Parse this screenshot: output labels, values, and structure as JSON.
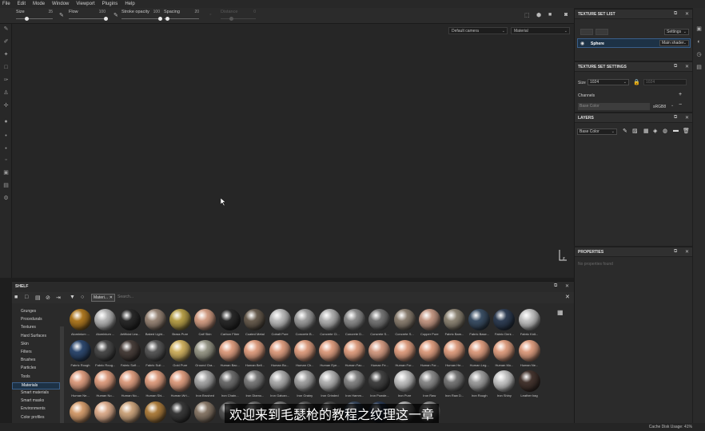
{
  "menu": [
    "File",
    "Edit",
    "Mode",
    "Window",
    "Viewport",
    "Plugins",
    "Help"
  ],
  "toolbar": {
    "size": {
      "label": "Size",
      "value": "35",
      "fill": 0.3
    },
    "flow": {
      "label": "Flow",
      "value": "100",
      "fill": 1.0
    },
    "stroke_opacity": {
      "label": "Stroke opacity",
      "value": "100",
      "fill": 1.0
    },
    "spacing": {
      "label": "Spacing",
      "value": "20",
      "fill": 0.1
    },
    "distance": {
      "label": "Distance",
      "value": "0",
      "fill": 0.3
    }
  },
  "viewport": {
    "camera": "Default camera",
    "mode": "Material"
  },
  "texture_set_list": {
    "title": "TEXTURE SET LIST",
    "settings_label": "Settings",
    "items": [
      {
        "name": "Sphere",
        "shader": "Main shader"
      }
    ]
  },
  "texture_set_settings": {
    "title": "TEXTURE SET SETTINGS",
    "size_label": "Size",
    "size_value": "1024",
    "size_value_2": "1024",
    "channels_label": "Channels",
    "channel": {
      "name": "Base Color",
      "format": "sRGB8"
    }
  },
  "layers": {
    "title": "LAYERS",
    "channel": "Base Color"
  },
  "properties": {
    "title": "PROPERTIES",
    "empty_text": "No properties found"
  },
  "shelf": {
    "title": "SHELF",
    "filter_tag": "Materi...",
    "search_placeholder": "Search...",
    "categories": [
      "Grunges",
      "Procedurals",
      "Textures",
      "Hard Surfaces",
      "Skin",
      "Filters",
      "Brushes",
      "Particles",
      "Tools",
      "Materials",
      "Smart materials",
      "Smart masks",
      "Environments",
      "Color profiles"
    ],
    "selected_category": "Materials",
    "materials": [
      {
        "name": "Aluminium ...",
        "color": "#b07a22"
      },
      {
        "name": "Aluminium ...",
        "color": "#b9b9b9"
      },
      {
        "name": "Artificial Lea...",
        "color": "#2a2a2a"
      },
      {
        "name": "Baked Light...",
        "color": "#9a8778"
      },
      {
        "name": "Brass Pure",
        "color": "#b9a14a"
      },
      {
        "name": "Calf Skin",
        "color": "#d6a086"
      },
      {
        "name": "Carbon Fiber",
        "color": "#2a2a2a"
      },
      {
        "name": "Coated Metal",
        "color": "#6a5e50"
      },
      {
        "name": "Cobalt Pure",
        "color": "#bfbfbf"
      },
      {
        "name": "Concrete B...",
        "color": "#9f9f9f"
      },
      {
        "name": "Concrete Cl...",
        "color": "#b3b3b3"
      },
      {
        "name": "Concrete D...",
        "color": "#8e8e8e"
      },
      {
        "name": "Concrete S...",
        "color": "#777777"
      },
      {
        "name": "Concrete S...",
        "color": "#8c8072"
      },
      {
        "name": "Copper Pure",
        "color": "#c79a86"
      },
      {
        "name": "Fabric Bam...",
        "color": "#8f8676"
      },
      {
        "name": "Fabric Base...",
        "color": "#3c5066"
      },
      {
        "name": "Fabric Deni...",
        "color": "#303f55"
      },
      {
        "name": "Fabric Knit...",
        "color": "#c6c6c6"
      },
      {
        "name": "Fabric Rough",
        "color": "#2f4a70"
      },
      {
        "name": "Fabric Roug...",
        "color": "#4b4b4b"
      },
      {
        "name": "Fabric Soft ...",
        "color": "#4a403c"
      },
      {
        "name": "Fabric Suit ...",
        "color": "#595959"
      },
      {
        "name": "Gold Pure",
        "color": "#d3b463"
      },
      {
        "name": "Ground Gra...",
        "color": "#9a9a8a"
      },
      {
        "name": "Human Bac...",
        "color": "#e2a183"
      },
      {
        "name": "Human Bell...",
        "color": "#e2a183"
      },
      {
        "name": "Human Bu...",
        "color": "#e2a183"
      },
      {
        "name": "Human Ch...",
        "color": "#e2a183"
      },
      {
        "name": "Human Eye...",
        "color": "#e2a183"
      },
      {
        "name": "Human Fac...",
        "color": "#e2a183"
      },
      {
        "name": "Human Fe...",
        "color": "#d89f86"
      },
      {
        "name": "Human For...",
        "color": "#e2a183"
      },
      {
        "name": "Human For...",
        "color": "#e2a183"
      },
      {
        "name": "Human He...",
        "color": "#e2a183"
      },
      {
        "name": "Human Leg...",
        "color": "#e2a183"
      },
      {
        "name": "Human Mo...",
        "color": "#e2a183"
      },
      {
        "name": "Human Ne...",
        "color": "#e2a183"
      },
      {
        "name": "Human Ne...",
        "color": "#e2a183"
      },
      {
        "name": "Human No...",
        "color": "#e2a183"
      },
      {
        "name": "Human No...",
        "color": "#e2a183"
      },
      {
        "name": "Human Shi...",
        "color": "#e2a183"
      },
      {
        "name": "Human Wri...",
        "color": "#e2a183"
      },
      {
        "name": "Iron Brushed",
        "color": "#a9a9a9"
      },
      {
        "name": "Iron Chain...",
        "color": "#6f6f6f"
      },
      {
        "name": "Iron Diamo...",
        "color": "#7c7c7c"
      },
      {
        "name": "Iron Galvan...",
        "color": "#b0b0b0"
      },
      {
        "name": "Iron Grainy",
        "color": "#a5a5a5"
      },
      {
        "name": "Iron Grinded",
        "color": "#b7b7b7"
      },
      {
        "name": "Iron Hamm...",
        "color": "#878787"
      },
      {
        "name": "Iron Powde...",
        "color": "#444444"
      },
      {
        "name": "Iron Pure",
        "color": "#c4c4c4"
      },
      {
        "name": "Iron Raw",
        "color": "#8d8d8d"
      },
      {
        "name": "Iron Raw D...",
        "color": "#787878"
      },
      {
        "name": "Iron Rough",
        "color": "#a1a1a1"
      },
      {
        "name": "Iron Shiny",
        "color": "#c9c9c9"
      },
      {
        "name": "Leather bag",
        "color": "#463630"
      },
      {
        "name": "",
        "color": "#d8a070"
      },
      {
        "name": "",
        "color": "#e0b090"
      },
      {
        "name": "",
        "color": "#d0a880"
      },
      {
        "name": "",
        "color": "#b08040"
      },
      {
        "name": "",
        "color": "#3a3a3a"
      },
      {
        "name": "",
        "color": "#8a7a6a"
      },
      {
        "name": "",
        "color": "#555555"
      },
      {
        "name": "",
        "color": "#6a6a6a"
      },
      {
        "name": "",
        "color": "#7a7a7a"
      },
      {
        "name": "",
        "color": "#5a5a5a"
      },
      {
        "name": "",
        "color": "#4a4a4a"
      },
      {
        "name": "",
        "color": "#3a4a60"
      },
      {
        "name": "",
        "color": "#2a3a55"
      },
      {
        "name": "",
        "color": "#b0b0b0"
      },
      {
        "name": "",
        "color": "#8a8a8a"
      }
    ]
  },
  "subtitle": "欢迎来到毛瑟枪的教程之纹理这一章",
  "status": {
    "cache_label": "Cache Disk Usage:",
    "cache_value": "41%"
  }
}
